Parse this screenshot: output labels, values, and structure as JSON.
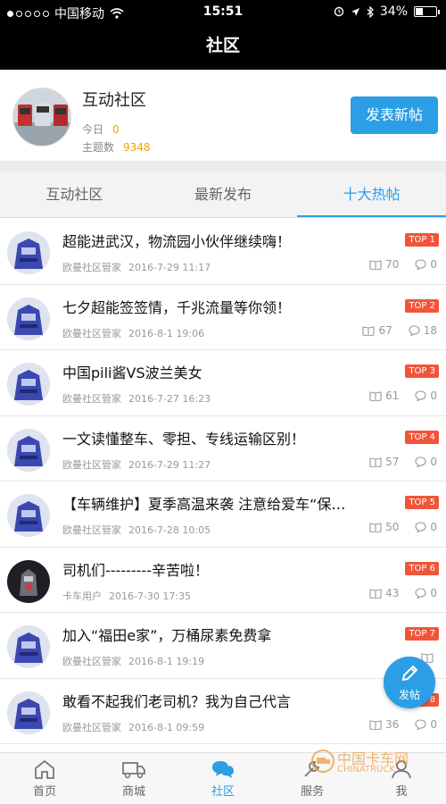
{
  "status": {
    "carrier": "中国移动",
    "time": "15:51",
    "battery": "34%"
  },
  "nav": {
    "title": "社区"
  },
  "community": {
    "name": "互动社区",
    "today_label": "今日",
    "today_value": "0",
    "topics_label": "主题数",
    "topics_value": "9348",
    "post_button": "发表新帖"
  },
  "tabs": [
    {
      "label": "互动社区"
    },
    {
      "label": "最新发布"
    },
    {
      "label": "十大热帖"
    }
  ],
  "posts": [
    {
      "title": "超能进武汉，物流园小伙伴继续嗨！",
      "author": "欧曼社区管家",
      "date": "2016-7-29 11:17",
      "badge": "TOP 1",
      "views": "70",
      "comments": "0"
    },
    {
      "title": "七夕超能签签情，千兆流量等你领！",
      "author": "欧曼社区管家",
      "date": "2016-8-1 19:06",
      "badge": "TOP 2",
      "views": "67",
      "comments": "18"
    },
    {
      "title": "中国pili酱VS波兰美女",
      "author": "欧曼社区管家",
      "date": "2016-7-27 16:23",
      "badge": "TOP 3",
      "views": "61",
      "comments": "0"
    },
    {
      "title": "一文读懂整车、零担、专线运输区别！",
      "author": "欧曼社区管家",
      "date": "2016-7-29 11:27",
      "badge": "TOP 4",
      "views": "57",
      "comments": "0"
    },
    {
      "title": "【车辆维护】夏季高温来袭 注意给爱车“保…",
      "author": "欧曼社区管家",
      "date": "2016-7-28 10:05",
      "badge": "TOP 5",
      "views": "50",
      "comments": "0"
    },
    {
      "title": "司机们---------辛苦啦！",
      "author": "卡车用户",
      "date": "2016-7-30 17:35",
      "badge": "TOP 6",
      "views": "43",
      "comments": "0"
    },
    {
      "title": "加入“福田e家”，万桶尿素免费拿",
      "author": "欧曼社区管家",
      "date": "2016-8-1 19:19",
      "badge": "TOP 7",
      "views": "",
      "comments": ""
    },
    {
      "title": "敢看不起我们老司机？我为自己代言",
      "author": "欧曼社区管家",
      "date": "2016-8-1 09:59",
      "badge": "TOP 8",
      "views": "36",
      "comments": "0"
    }
  ],
  "fab": {
    "label": "发帖"
  },
  "bottom_nav": [
    {
      "label": "首页"
    },
    {
      "label": "商城"
    },
    {
      "label": "社区"
    },
    {
      "label": "服务"
    },
    {
      "label": "我"
    }
  ],
  "watermark": {
    "line1": "中国卡车网",
    "line2": "CHINATRUCK"
  },
  "colors": {
    "accent": "#2b9ee6",
    "badge": "#f0553a",
    "stat": "#f0a500"
  }
}
